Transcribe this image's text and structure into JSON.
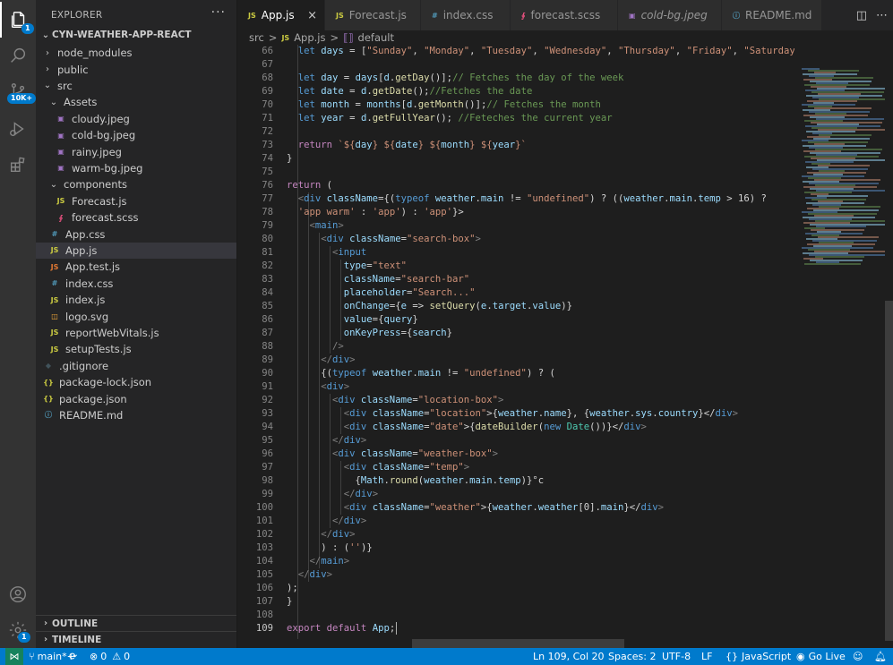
{
  "activity": {
    "explorer_badge": "1",
    "scm_badge": "10K+",
    "settings_badge": "1"
  },
  "sidebar": {
    "title": "EXPLORER",
    "more": "···",
    "project": "CYN-WEATHER-APP-REACT",
    "tree": [
      {
        "label": "node_modules",
        "type": "folder-closed",
        "depth": 1
      },
      {
        "label": "public",
        "type": "folder-closed",
        "depth": 1
      },
      {
        "label": "src",
        "type": "folder-open",
        "depth": 1
      },
      {
        "label": "Assets",
        "type": "folder-open",
        "depth": 2
      },
      {
        "label": "cloudy.jpeg",
        "type": "image",
        "depth": 3
      },
      {
        "label": "cold-bg.jpeg",
        "type": "image",
        "depth": 3
      },
      {
        "label": "rainy.jpeg",
        "type": "image",
        "depth": 3
      },
      {
        "label": "warm-bg.jpeg",
        "type": "image",
        "depth": 3
      },
      {
        "label": "components",
        "type": "folder-open",
        "depth": 2
      },
      {
        "label": "Forecast.js",
        "type": "js",
        "depth": 3
      },
      {
        "label": "forecast.scss",
        "type": "scss",
        "depth": 3
      },
      {
        "label": "App.css",
        "type": "css",
        "depth": 2
      },
      {
        "label": "App.js",
        "type": "js",
        "depth": 2,
        "selected": true
      },
      {
        "label": "App.test.js",
        "type": "test",
        "depth": 2
      },
      {
        "label": "index.css",
        "type": "css",
        "depth": 2
      },
      {
        "label": "index.js",
        "type": "js",
        "depth": 2
      },
      {
        "label": "logo.svg",
        "type": "svg",
        "depth": 2
      },
      {
        "label": "reportWebVitals.js",
        "type": "js",
        "depth": 2
      },
      {
        "label": "setupTests.js",
        "type": "js",
        "depth": 2
      },
      {
        "label": ".gitignore",
        "type": "git",
        "depth": 1
      },
      {
        "label": "package-lock.json",
        "type": "json",
        "depth": 1
      },
      {
        "label": "package.json",
        "type": "json",
        "depth": 1
      },
      {
        "label": "README.md",
        "type": "info",
        "depth": 1
      }
    ],
    "outline": "OUTLINE",
    "timeline": "TIMELINE"
  },
  "tabs": [
    {
      "label": "App.js",
      "icon": "JS",
      "active": true,
      "close": "×"
    },
    {
      "label": "Forecast.js",
      "icon": "JS",
      "active": false
    },
    {
      "label": "index.css",
      "icon": "#",
      "active": false
    },
    {
      "label": "forecast.scss",
      "icon": "scss",
      "active": false
    },
    {
      "label": "cold-bg.jpeg",
      "icon": "img",
      "active": false
    },
    {
      "label": "README.md",
      "icon": "info",
      "active": false
    }
  ],
  "breadcrumb": {
    "folder": "src",
    "sep": ">",
    "file": "App.js",
    "symbol": "default"
  },
  "editor": {
    "first_line": 66,
    "current_line": 109,
    "lines": [
      [
        [
          "  let ",
          "kw"
        ],
        [
          "days",
          "var"
        ],
        [
          " = ",
          ""
        ],
        [
          "[",
          ""
        ],
        [
          "\"Sunday\"",
          "str"
        ],
        [
          ", ",
          ""
        ],
        [
          "\"Monday\"",
          "str"
        ],
        [
          ", ",
          ""
        ],
        [
          "\"Tuesday\"",
          "str"
        ],
        [
          ", ",
          ""
        ],
        [
          "\"Wednesday\"",
          "str"
        ],
        [
          ", ",
          ""
        ],
        [
          "\"Thursday\"",
          "str"
        ],
        [
          ", ",
          ""
        ],
        [
          "\"Friday\"",
          "str"
        ],
        [
          ", ",
          ""
        ],
        [
          "\"Saturday\"",
          "str"
        ],
        [
          "];",
          ""
        ]
      ],
      [],
      [
        [
          "  let ",
          "kw"
        ],
        [
          "day",
          "var"
        ],
        [
          " = ",
          ""
        ],
        [
          "days",
          "var"
        ],
        [
          "[",
          ""
        ],
        [
          "d",
          "var"
        ],
        [
          ".",
          ""
        ],
        [
          "getDay",
          "fn"
        ],
        [
          "()",
          ""
        ],
        [
          "];",
          ""
        ],
        [
          "// Fetches the day of the week",
          "cmt"
        ]
      ],
      [
        [
          "  let ",
          "kw"
        ],
        [
          "date",
          "var"
        ],
        [
          " = ",
          ""
        ],
        [
          "d",
          "var"
        ],
        [
          ".",
          ""
        ],
        [
          "getDate",
          "fn"
        ],
        [
          "();",
          ""
        ],
        [
          "//Fetches the date",
          "cmt"
        ]
      ],
      [
        [
          "  let ",
          "kw"
        ],
        [
          "month",
          "var"
        ],
        [
          " = ",
          ""
        ],
        [
          "months",
          "var"
        ],
        [
          "[",
          ""
        ],
        [
          "d",
          "var"
        ],
        [
          ".",
          ""
        ],
        [
          "getMonth",
          "fn"
        ],
        [
          "()",
          ""
        ],
        [
          "];",
          ""
        ],
        [
          "// Fetches the month",
          "cmt"
        ]
      ],
      [
        [
          "  let ",
          "kw"
        ],
        [
          "year",
          "var"
        ],
        [
          " = ",
          ""
        ],
        [
          "d",
          "var"
        ],
        [
          ".",
          ""
        ],
        [
          "getFullYear",
          "fn"
        ],
        [
          "(); ",
          ""
        ],
        [
          "//Feteches the current year",
          "cmt"
        ]
      ],
      [],
      [
        [
          "  return ",
          "ctrl"
        ],
        [
          "`${",
          "str"
        ],
        [
          "day",
          "var"
        ],
        [
          "} ${",
          "str"
        ],
        [
          "date",
          "var"
        ],
        [
          "} ${",
          "str"
        ],
        [
          "month",
          "var"
        ],
        [
          "} ${",
          "str"
        ],
        [
          "year",
          "var"
        ],
        [
          "}`",
          "str"
        ]
      ],
      [
        [
          "}",
          ""
        ]
      ],
      [],
      [
        [
          "return ",
          "ctrl"
        ],
        [
          "(",
          ""
        ]
      ],
      [
        [
          "  <",
          "punc"
        ],
        [
          "div ",
          "tag"
        ],
        [
          "className",
          "attr"
        ],
        [
          "=",
          ""
        ],
        [
          "{(",
          ""
        ],
        [
          "typeof ",
          "kw"
        ],
        [
          "weather",
          "var"
        ],
        [
          ".",
          ""
        ],
        [
          "main",
          "var"
        ],
        [
          " != ",
          ""
        ],
        [
          "\"undefined\"",
          "str"
        ],
        [
          ") ? ((",
          ""
        ],
        [
          "weather",
          "var"
        ],
        [
          ".",
          ""
        ],
        [
          "main",
          "var"
        ],
        [
          ".",
          ""
        ],
        [
          "temp",
          "var"
        ],
        [
          " > 16) ?",
          ""
        ]
      ],
      [
        [
          "  'app warm'",
          "str"
        ],
        [
          " : ",
          ""
        ],
        [
          "'app'",
          "str"
        ],
        [
          ") : ",
          ""
        ],
        [
          "'app'",
          "str"
        ],
        [
          "}>",
          ""
        ]
      ],
      [
        [
          "    <",
          "punc"
        ],
        [
          "main",
          "tag"
        ],
        [
          ">",
          "punc"
        ]
      ],
      [
        [
          "      <",
          "punc"
        ],
        [
          "div ",
          "tag"
        ],
        [
          "className",
          "attr"
        ],
        [
          "=",
          ""
        ],
        [
          "\"search-box\"",
          "str"
        ],
        [
          ">",
          "punc"
        ]
      ],
      [
        [
          "        <",
          "punc"
        ],
        [
          "input",
          "tag"
        ]
      ],
      [
        [
          "          type",
          "attr"
        ],
        [
          "=",
          ""
        ],
        [
          "\"text\"",
          "str"
        ]
      ],
      [
        [
          "          className",
          "attr"
        ],
        [
          "=",
          ""
        ],
        [
          "\"search-bar\"",
          "str"
        ]
      ],
      [
        [
          "          placeholder",
          "attr"
        ],
        [
          "=",
          ""
        ],
        [
          "\"Search...\"",
          "str"
        ]
      ],
      [
        [
          "          onChange",
          "attr"
        ],
        [
          "=",
          ""
        ],
        [
          "{",
          ""
        ],
        [
          "e",
          "var"
        ],
        [
          " => ",
          ""
        ],
        [
          "setQuery",
          "fn"
        ],
        [
          "(",
          ""
        ],
        [
          "e",
          "var"
        ],
        [
          ".",
          ""
        ],
        [
          "target",
          "var"
        ],
        [
          ".",
          ""
        ],
        [
          "value",
          "var"
        ],
        [
          ")}",
          ""
        ]
      ],
      [
        [
          "          value",
          "attr"
        ],
        [
          "=",
          ""
        ],
        [
          "{",
          ""
        ],
        [
          "query",
          "var"
        ],
        [
          "}",
          ""
        ]
      ],
      [
        [
          "          onKeyPress",
          "attr"
        ],
        [
          "=",
          ""
        ],
        [
          "{",
          ""
        ],
        [
          "search",
          "var"
        ],
        [
          "}",
          ""
        ]
      ],
      [
        [
          "        />",
          "punc"
        ]
      ],
      [
        [
          "      </",
          "punc"
        ],
        [
          "div",
          "tag"
        ],
        [
          ">",
          "punc"
        ]
      ],
      [
        [
          "      {(",
          ""
        ],
        [
          "typeof ",
          "kw"
        ],
        [
          "weather",
          "var"
        ],
        [
          ".",
          ""
        ],
        [
          "main",
          "var"
        ],
        [
          " != ",
          ""
        ],
        [
          "\"undefined\"",
          "str"
        ],
        [
          ") ? (",
          ""
        ]
      ],
      [
        [
          "      <",
          "punc"
        ],
        [
          "div",
          "tag"
        ],
        [
          ">",
          "punc"
        ]
      ],
      [
        [
          "        <",
          "punc"
        ],
        [
          "div ",
          "tag"
        ],
        [
          "className",
          "attr"
        ],
        [
          "=",
          ""
        ],
        [
          "\"location-box\"",
          "str"
        ],
        [
          ">",
          "punc"
        ]
      ],
      [
        [
          "          <",
          "punc"
        ],
        [
          "div ",
          "tag"
        ],
        [
          "className",
          "attr"
        ],
        [
          "=",
          ""
        ],
        [
          "\"location\"",
          "str"
        ],
        [
          ">{",
          ""
        ],
        [
          "weather",
          "var"
        ],
        [
          ".",
          ""
        ],
        [
          "name",
          "var"
        ],
        [
          "}, {",
          ""
        ],
        [
          "weather",
          "var"
        ],
        [
          ".",
          ""
        ],
        [
          "sys",
          "var"
        ],
        [
          ".",
          ""
        ],
        [
          "country",
          "var"
        ],
        [
          "}</",
          ""
        ],
        [
          "div",
          "tag"
        ],
        [
          ">",
          "punc"
        ]
      ],
      [
        [
          "          <",
          "punc"
        ],
        [
          "div ",
          "tag"
        ],
        [
          "className",
          "attr"
        ],
        [
          "=",
          ""
        ],
        [
          "\"date\"",
          "str"
        ],
        [
          ">{",
          ""
        ],
        [
          "dateBuilder",
          "fn"
        ],
        [
          "(",
          ""
        ],
        [
          "new ",
          "kw"
        ],
        [
          "Date",
          "obj"
        ],
        [
          "())}</",
          ""
        ],
        [
          "div",
          "tag"
        ],
        [
          ">",
          "punc"
        ]
      ],
      [
        [
          "        </",
          "punc"
        ],
        [
          "div",
          "tag"
        ],
        [
          ">",
          "punc"
        ]
      ],
      [
        [
          "        <",
          "punc"
        ],
        [
          "div ",
          "tag"
        ],
        [
          "className",
          "attr"
        ],
        [
          "=",
          ""
        ],
        [
          "\"weather-box\"",
          "str"
        ],
        [
          ">",
          "punc"
        ]
      ],
      [
        [
          "          <",
          "punc"
        ],
        [
          "div ",
          "tag"
        ],
        [
          "className",
          "attr"
        ],
        [
          "=",
          ""
        ],
        [
          "\"temp\"",
          "str"
        ],
        [
          ">",
          "punc"
        ]
      ],
      [
        [
          "            {",
          ""
        ],
        [
          "Math",
          "var"
        ],
        [
          ".",
          ""
        ],
        [
          "round",
          "fn"
        ],
        [
          "(",
          ""
        ],
        [
          "weather",
          "var"
        ],
        [
          ".",
          ""
        ],
        [
          "main",
          "var"
        ],
        [
          ".",
          ""
        ],
        [
          "temp",
          "var"
        ],
        [
          ")}°c",
          ""
        ]
      ],
      [
        [
          "          </",
          "punc"
        ],
        [
          "div",
          "tag"
        ],
        [
          ">",
          "punc"
        ]
      ],
      [
        [
          "          <",
          "punc"
        ],
        [
          "div ",
          "tag"
        ],
        [
          "className",
          "attr"
        ],
        [
          "=",
          ""
        ],
        [
          "\"weather\"",
          "str"
        ],
        [
          ">{",
          ""
        ],
        [
          "weather",
          "var"
        ],
        [
          ".",
          ""
        ],
        [
          "weather",
          "var"
        ],
        [
          "[0].",
          ""
        ],
        [
          "main",
          "var"
        ],
        [
          "}</",
          ""
        ],
        [
          "div",
          "tag"
        ],
        [
          ">",
          "punc"
        ]
      ],
      [
        [
          "        </",
          "punc"
        ],
        [
          "div",
          "tag"
        ],
        [
          ">",
          "punc"
        ]
      ],
      [
        [
          "      </",
          "punc"
        ],
        [
          "div",
          "tag"
        ],
        [
          ">",
          "punc"
        ]
      ],
      [
        [
          "      ) : (",
          ""
        ],
        [
          "''",
          "str"
        ],
        [
          ")}",
          ""
        ]
      ],
      [
        [
          "    </",
          "punc"
        ],
        [
          "main",
          "tag"
        ],
        [
          ">",
          "punc"
        ]
      ],
      [
        [
          "  </",
          "punc"
        ],
        [
          "div",
          "tag"
        ],
        [
          ">",
          "punc"
        ]
      ],
      [
        [
          ");",
          ""
        ]
      ],
      [
        [
          "}",
          ""
        ]
      ],
      [],
      [
        [
          "export ",
          "ctrl"
        ],
        [
          "default ",
          "ctrl"
        ],
        [
          "App",
          "var"
        ],
        [
          ";",
          ""
        ]
      ]
    ]
  },
  "statusbar": {
    "branch": "main*+",
    "errors": "0",
    "warnings": "0",
    "position": "Ln 109, Col 20",
    "spaces": "Spaces: 2",
    "encoding": "UTF-8",
    "eol": "LF",
    "language": "JavaScript",
    "golive": "Go Live"
  },
  "colors": {
    "accent": "#007acc",
    "js_yellow": "#cbcb41",
    "css_blue": "#519aba",
    "scss_pink": "#f55385",
    "img_purple": "#a074c4",
    "json_yellow": "#cbcb41"
  }
}
